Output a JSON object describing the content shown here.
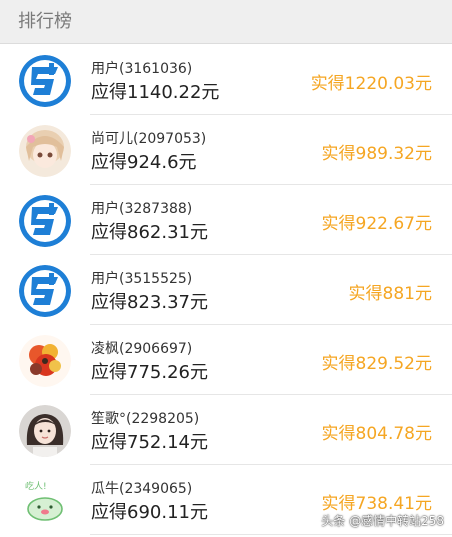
{
  "header": {
    "title": "排行榜"
  },
  "rows": [
    {
      "name": "用户(3161036)",
      "due": "应得1140.22元",
      "received": "实得1220.03元",
      "avatar": "bang-logo-icon"
    },
    {
      "name": "尚可儿(2097053)",
      "due": "应得924.6元",
      "received": "实得989.32元",
      "avatar": "anime-girl-avatar"
    },
    {
      "name": "用户(3287388)",
      "due": "应得862.31元",
      "received": "实得922.67元",
      "avatar": "bang-logo-icon"
    },
    {
      "name": "用户(3515525)",
      "due": "应得823.37元",
      "received": "实得881元",
      "avatar": "bang-logo-icon"
    },
    {
      "name": "凌枫(2906697)",
      "due": "应得775.26元",
      "received": "实得829.52元",
      "avatar": "flower-avatar"
    },
    {
      "name": "笙歌°(2298205)",
      "due": "应得752.14元",
      "received": "实得804.78元",
      "avatar": "girl-photo-avatar"
    },
    {
      "name": "瓜牛(2349065)",
      "due": "应得690.11元",
      "received": "实得738.41元",
      "avatar": "cartoon-avatar"
    }
  ],
  "watermark": "头条 @感情中转站258",
  "colors": {
    "accent": "#f5a623",
    "logo_blue": "#1e7fd6",
    "header_bg": "#efefef"
  }
}
